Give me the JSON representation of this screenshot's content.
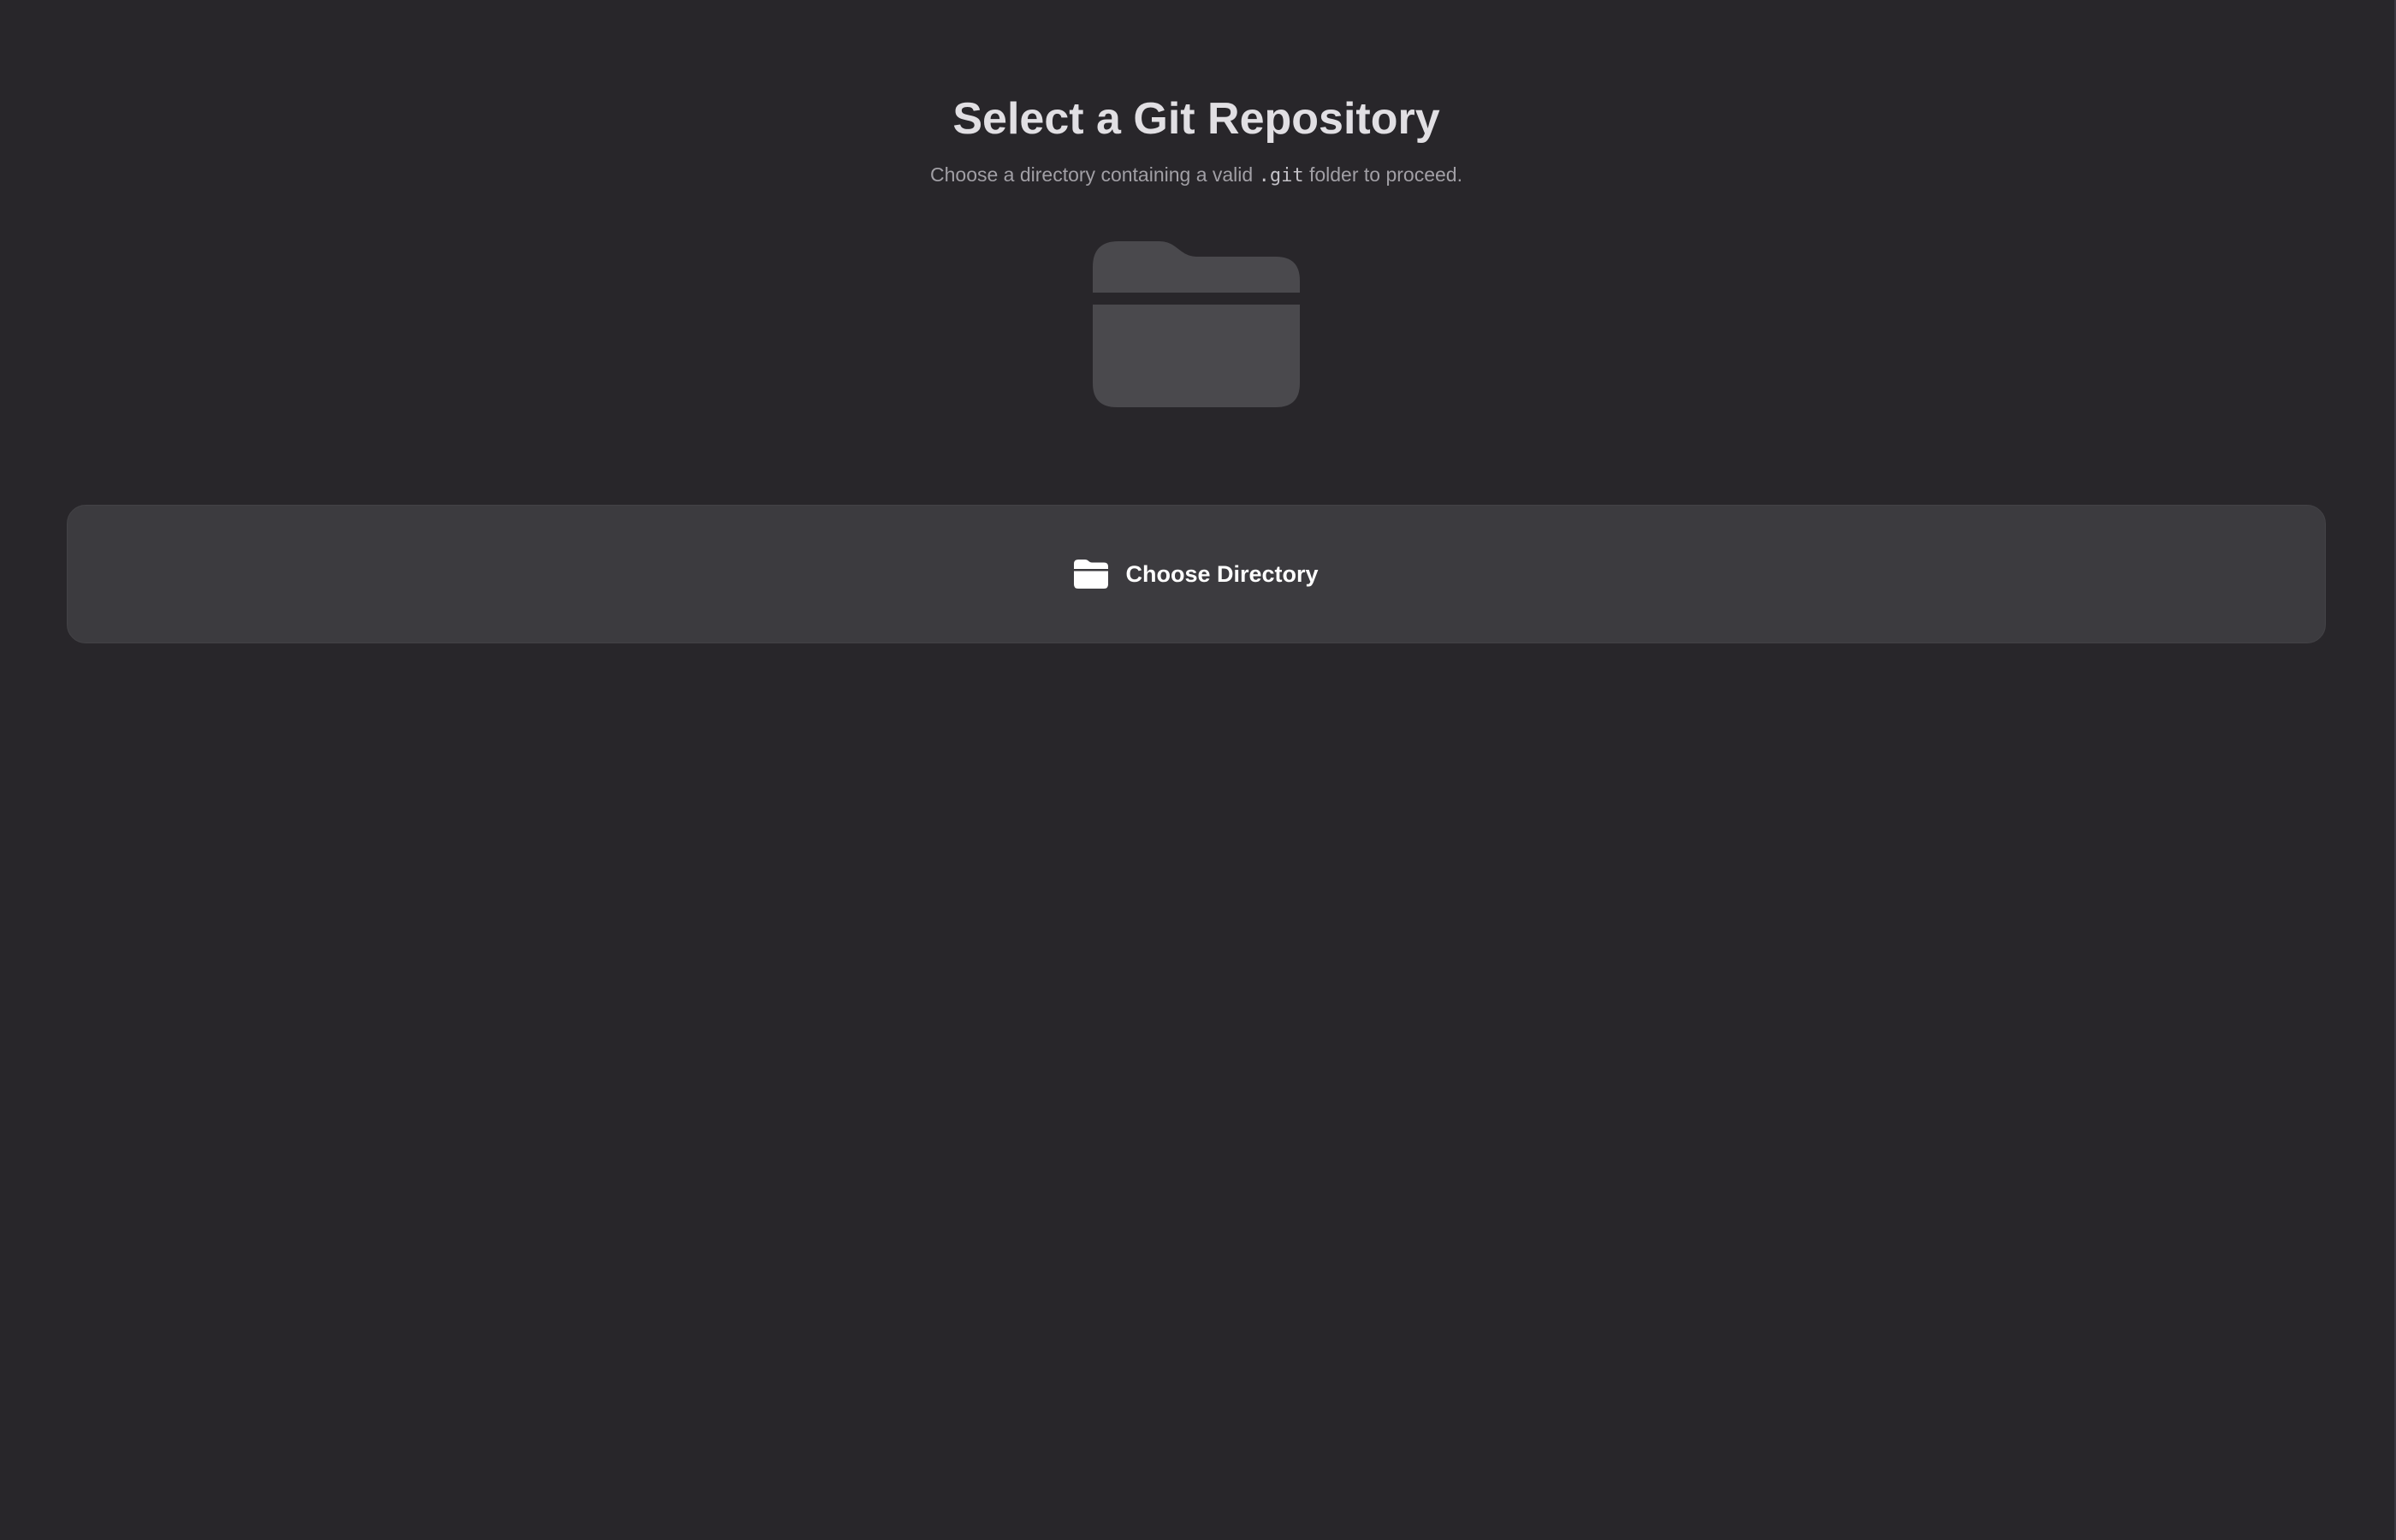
{
  "header": {
    "title": "Select a Git Repository",
    "subtitle_before": "Choose a directory containing a valid ",
    "subtitle_code": ".git",
    "subtitle_after": " folder to proceed."
  },
  "illustration": {
    "icon": "folder-icon",
    "color": "#4a494d"
  },
  "choose_button": {
    "label": "Choose Directory",
    "icon": "folder-icon",
    "background": "#3c3b3f"
  },
  "colors": {
    "background": "#28262a",
    "title": "#e1dfe3",
    "subtitle": "#a19fa5"
  }
}
